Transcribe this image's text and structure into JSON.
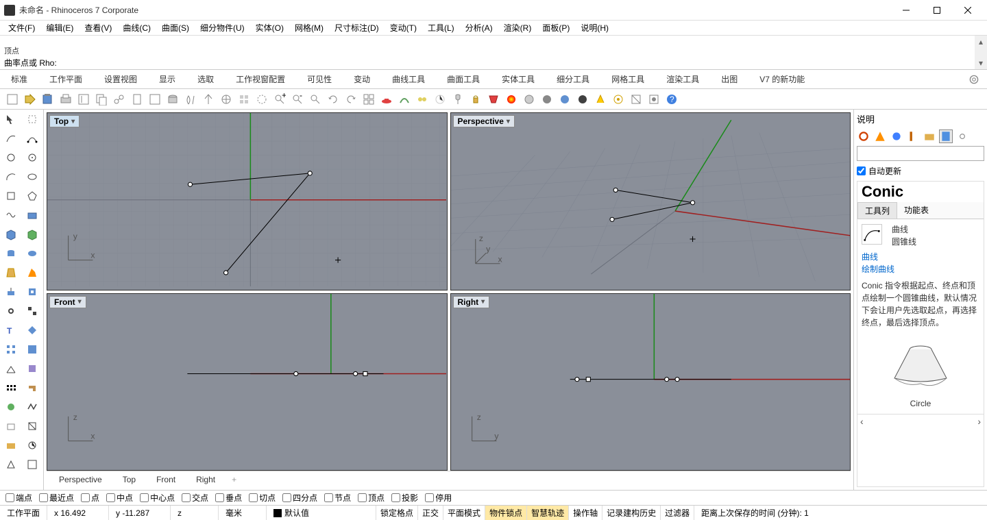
{
  "title": "未命名 - Rhinoceros 7 Corporate",
  "menu": [
    "文件(F)",
    "编辑(E)",
    "查看(V)",
    "曲线(C)",
    "曲面(S)",
    "细分物件(U)",
    "实体(O)",
    "网格(M)",
    "尺寸标注(D)",
    "变动(T)",
    "工具(L)",
    "分析(A)",
    "渲染(R)",
    "面板(P)",
    "说明(H)"
  ],
  "cmd_history": "顶点",
  "cmd_prompt": "曲率点或 Rho:",
  "tabs": [
    "标准",
    "工作平面",
    "设置视图",
    "显示",
    "选取",
    "工作视窗配置",
    "可见性",
    "变动",
    "曲线工具",
    "曲面工具",
    "实体工具",
    "细分工具",
    "网格工具",
    "渲染工具",
    "出图",
    "V7 的新功能"
  ],
  "viewports": {
    "top": "Top",
    "perspective": "Perspective",
    "front": "Front",
    "right": "Right"
  },
  "vp_tabs": [
    "Perspective",
    "Top",
    "Front",
    "Right"
  ],
  "right_panel": {
    "title": "说明",
    "auto_update": "自动更新",
    "help_title": "Conic",
    "help_tabs": [
      "工具列",
      "功能表"
    ],
    "help_sub1": "曲线",
    "help_sub2": "圆锥线",
    "help_link1": "曲线",
    "help_link2": "绘制曲线",
    "help_text": "Conic 指令根据起点、终点和顶点绘制一个圆锥曲线，默认情况下会让用户先选取起点，再选择终点，最后选择顶点。",
    "help_circle": "Circle"
  },
  "osnap": [
    "端点",
    "最近点",
    "点",
    "中点",
    "中心点",
    "交点",
    "垂点",
    "切点",
    "四分点",
    "节点",
    "顶点",
    "投影",
    "停用"
  ],
  "status": {
    "cplane": "工作平面",
    "x": "x 16.492",
    "y": "y -11.287",
    "z": "z",
    "units": "毫米",
    "layer": "默认值",
    "toggles": [
      "锁定格点",
      "正交",
      "平面模式",
      "物件锁点",
      "智慧轨迹",
      "操作轴",
      "记录建构历史",
      "过滤器"
    ],
    "save_time": "距离上次保存的时间 (分钟): 1"
  }
}
